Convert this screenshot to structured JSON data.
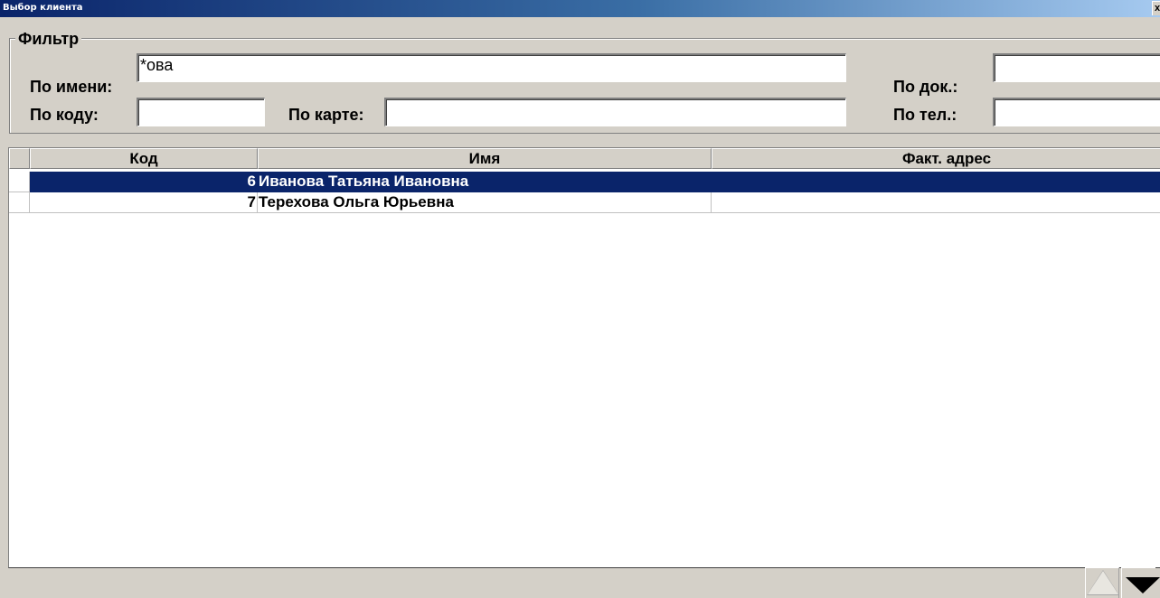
{
  "window": {
    "title": "Выбор клиента",
    "close_glyph": "x"
  },
  "filter": {
    "legend": "Фильтр",
    "by_name_label": "По имени:",
    "by_name_value": "*ова",
    "by_code_label": "По коду:",
    "by_code_value": "",
    "by_card_label": "По карте:",
    "by_card_value": "",
    "by_doc_label": "По док.:",
    "by_doc_value": "",
    "by_phone_label": "По тел.:",
    "by_phone_value": ""
  },
  "grid": {
    "columns": [
      "Код",
      "Имя",
      "Факт. адрес"
    ],
    "rows": [
      {
        "code": "6",
        "name": "Иванова Татьяна Ивановна",
        "address": "",
        "selected": true
      },
      {
        "code": "7",
        "name": "Терехова Ольга Юрьевна",
        "address": "",
        "selected": false
      }
    ]
  },
  "nav": {
    "up_icon": "triangle-up-icon",
    "down_icon": "triangle-down-icon"
  },
  "colors": {
    "selection": "#0a246a",
    "title_start": "#0a246a",
    "title_end": "#a6caf0",
    "face": "#d4d0c8"
  }
}
